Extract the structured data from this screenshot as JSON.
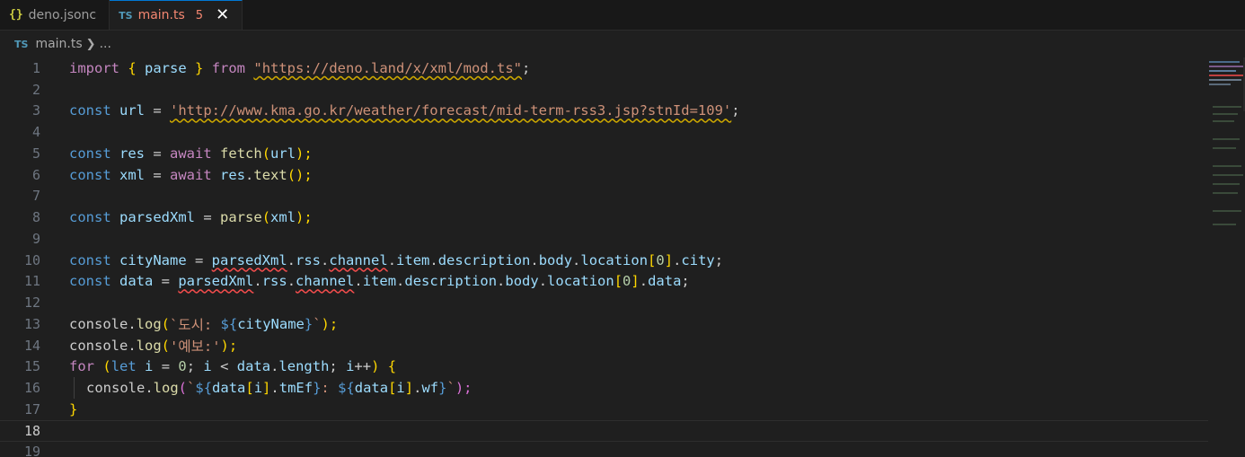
{
  "tabs": [
    {
      "icon": "{}",
      "label": "deno.jsonc"
    },
    {
      "icon": "TS",
      "label": "main.ts",
      "badge": "5",
      "close": "✕"
    }
  ],
  "breadcrumb": {
    "icon": "TS",
    "file": "main.ts",
    "rest": "..."
  },
  "editor": {
    "line_numbers": [
      "1",
      "2",
      "3",
      "4",
      "5",
      "6",
      "7",
      "8",
      "9",
      "10",
      "11",
      "12",
      "13",
      "14",
      "15",
      "16",
      "17",
      "18",
      "19"
    ],
    "tokens": {
      "l1": [
        "import",
        " ",
        "{",
        " parse ",
        "}",
        " from ",
        "\"https://deno.land/x/xml/mod.ts\"",
        ";"
      ],
      "l3": [
        "const",
        " ",
        "url",
        " = ",
        "'http://www.kma.go.kr/weather/forecast/mid-term-rss3.jsp?stnId=109'",
        ";"
      ],
      "l5": [
        "const",
        " ",
        "res",
        " = ",
        "await",
        " ",
        "fetch",
        "(",
        "url",
        ");"
      ],
      "l6": [
        "const",
        " ",
        "xml",
        " = ",
        "await",
        " ",
        "res",
        ".",
        "text",
        "();"
      ],
      "l8": [
        "const",
        " ",
        "parsedXml",
        " = ",
        "parse",
        "(",
        "xml",
        ");"
      ],
      "l10": [
        "const",
        " ",
        "cityName",
        " = ",
        "parsedXml",
        ".",
        "rss",
        ".",
        "channel",
        ".",
        "item",
        ".",
        "description",
        ".",
        "body",
        ".",
        "location",
        "[",
        "0",
        "]",
        ".",
        "city",
        ";"
      ],
      "l11": [
        "const",
        " ",
        "data",
        " = ",
        "parsedXml",
        ".",
        "rss",
        ".",
        "channel",
        ".",
        "item",
        ".",
        "description",
        ".",
        "body",
        ".",
        "location",
        "[",
        "0",
        "]",
        ".",
        "data",
        ";"
      ],
      "l13": [
        "console",
        ".",
        "log",
        "(",
        "`도시: ",
        "${",
        "cityName",
        "}",
        "`",
        ");"
      ],
      "l14": [
        "console",
        ".",
        "log",
        "(",
        "'예보:'",
        ");"
      ],
      "l15": [
        "for",
        " ",
        "(",
        "let",
        " ",
        "i",
        " = ",
        "0",
        "; ",
        "i",
        " < ",
        "data",
        ".",
        "length",
        "; ",
        "i",
        "++",
        ") ",
        "{"
      ],
      "l16": [
        "console",
        ".",
        "log",
        "(",
        "`",
        "${",
        "data",
        "[",
        "i",
        "]",
        ".",
        "tmEf",
        "}",
        ": ",
        "${",
        "data",
        "[",
        "i",
        "]",
        ".",
        "wf",
        "}",
        "`",
        ");"
      ],
      "l17": [
        "}"
      ]
    }
  },
  "colors": {
    "keyword": "#569cd6",
    "control": "#c586c0",
    "variable": "#9cdcfe",
    "function": "#dcdcaa",
    "string": "#ce9178",
    "number": "#b5cea8",
    "bracket": "#ffd700",
    "warning": "#cca700",
    "error": "#f14c4c"
  }
}
